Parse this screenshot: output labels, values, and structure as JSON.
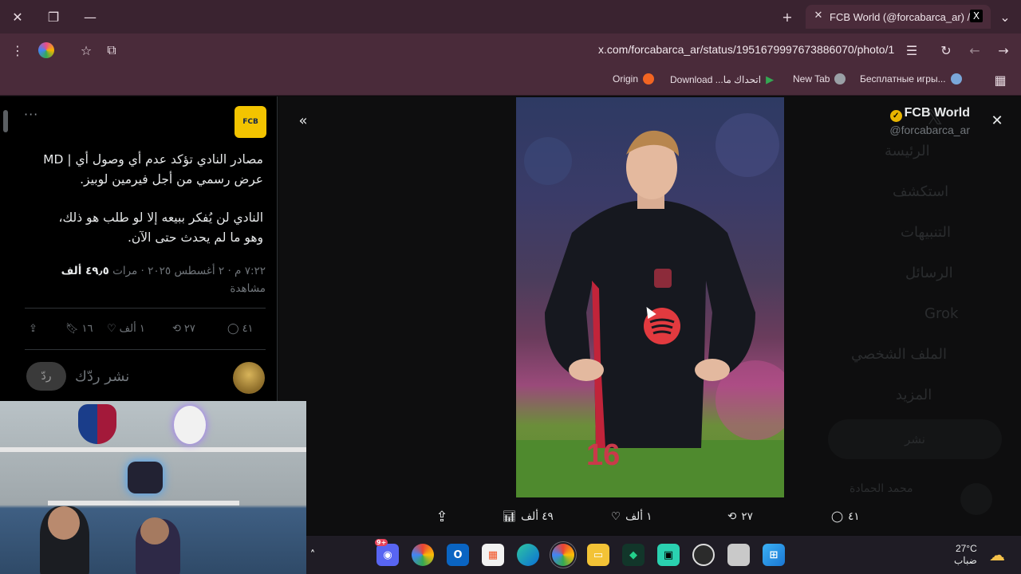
{
  "browser": {
    "tab_title": "FCB World (@forcabarca_ar) / X",
    "tab_favicon": "X",
    "url": "x.com/forcabarca_ar/status/1951679997673886070/photo/1",
    "bookmarks": [
      {
        "label": "Origin",
        "icon": "origin-icon",
        "color": "#f26522"
      },
      {
        "label": "Download ...اتحداك ما",
        "icon": "play-store-icon",
        "color": "#34a853"
      },
      {
        "label": "New Tab",
        "icon": "globe-icon",
        "color": "#9aa0a6"
      },
      {
        "label": "Бесплатные игры...",
        "icon": "game-icon",
        "color": "#7aa7d9"
      }
    ]
  },
  "tweet": {
    "author_name": "FCB World",
    "author_handle": "@forcabarca_ar",
    "avatar_text": "FCB",
    "text_line1": "مصادر النادي تؤكد عدم أي وصول أي | MD",
    "text_line2": "عرض رسمي من أجل فيرمين لوبيز.",
    "text_line3": "النادي لن يُفكر ببيعه إلا لو طلب هو ذلك،",
    "text_line4": "وهو ما لم يحدث حتى الآن.",
    "meta_time": "٧:٢٢ م · ٢ أغسطس ٢٠٢٥ · مرات",
    "meta_views": "٤٩٫٥ ألف",
    "meta_views_label": "مشاهدة",
    "replies": "٤١",
    "reposts": "٢٧",
    "likes": "١ ألف",
    "bookmarks": "١٦",
    "reply_button": "ردّ",
    "reply_placeholder": "نشر ردّك"
  },
  "viewer": {
    "replies": "٤١",
    "reposts": "٢٧",
    "likes": "١ ألف",
    "views": "٤٩ ألف",
    "photo_number": "16"
  },
  "background_nav": [
    "الرئيسة",
    "استكشف",
    "التنبيهات",
    "الرسائل",
    "Grok",
    "الملف الشخصي",
    "المزيد"
  ],
  "background_post_button": "نشر",
  "background_user": "محمد الحمادة",
  "taskbar": {
    "weather_temp": "27°C",
    "weather_desc": "ضباب",
    "discord_badge": "9+"
  }
}
